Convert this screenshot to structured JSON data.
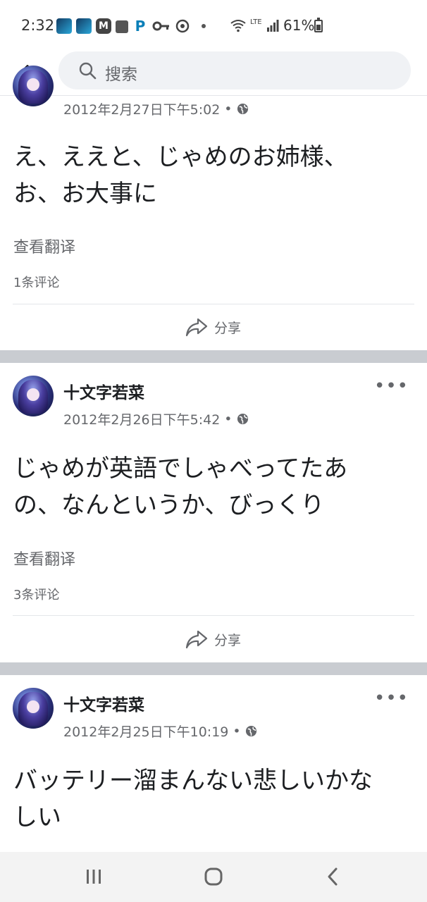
{
  "status_bar": {
    "time": "2:32",
    "network": "LTE",
    "battery": "61%",
    "battery_level": 0.61
  },
  "header": {
    "search_placeholder": "搜索"
  },
  "posts": [
    {
      "author": "",
      "timestamp": "2012年2月27日下午5:02",
      "privacy_sep": "•",
      "text_line1": "え、ええと、じゃめのお姉様、",
      "text_line2": "お、お大事に",
      "translate_label": "查看翻译",
      "comments": "1条评论",
      "share_label": "分享"
    },
    {
      "author": "十文字若菜",
      "timestamp": "2012年2月26日下午5:42",
      "privacy_sep": "•",
      "more": "•••",
      "text_line1": "じゃめが英語でしゃべってたあ",
      "text_line2": "の、なんというか、びっくり",
      "translate_label": "查看翻译",
      "comments": "3条评论",
      "share_label": "分享"
    },
    {
      "author": "十文字若菜",
      "timestamp": "2012年2月25日下午10:19",
      "privacy_sep": "•",
      "more": "•••",
      "text_line1": "バッテリー溜まんない悲しいかな",
      "text_line2": "しい"
    }
  ],
  "icons": {
    "back": "arrow-left-icon",
    "search": "magnifier-icon",
    "globe": "globe-icon",
    "share": "share-arrow-icon",
    "more": "ellipsis-icon",
    "nav_recent": "recent-apps-icon",
    "nav_home": "home-icon",
    "nav_back": "chevron-left-icon"
  },
  "colors": {
    "divider": "#c9ccd1",
    "secondary_text": "#65676b",
    "search_bg": "#f0f2f5"
  }
}
